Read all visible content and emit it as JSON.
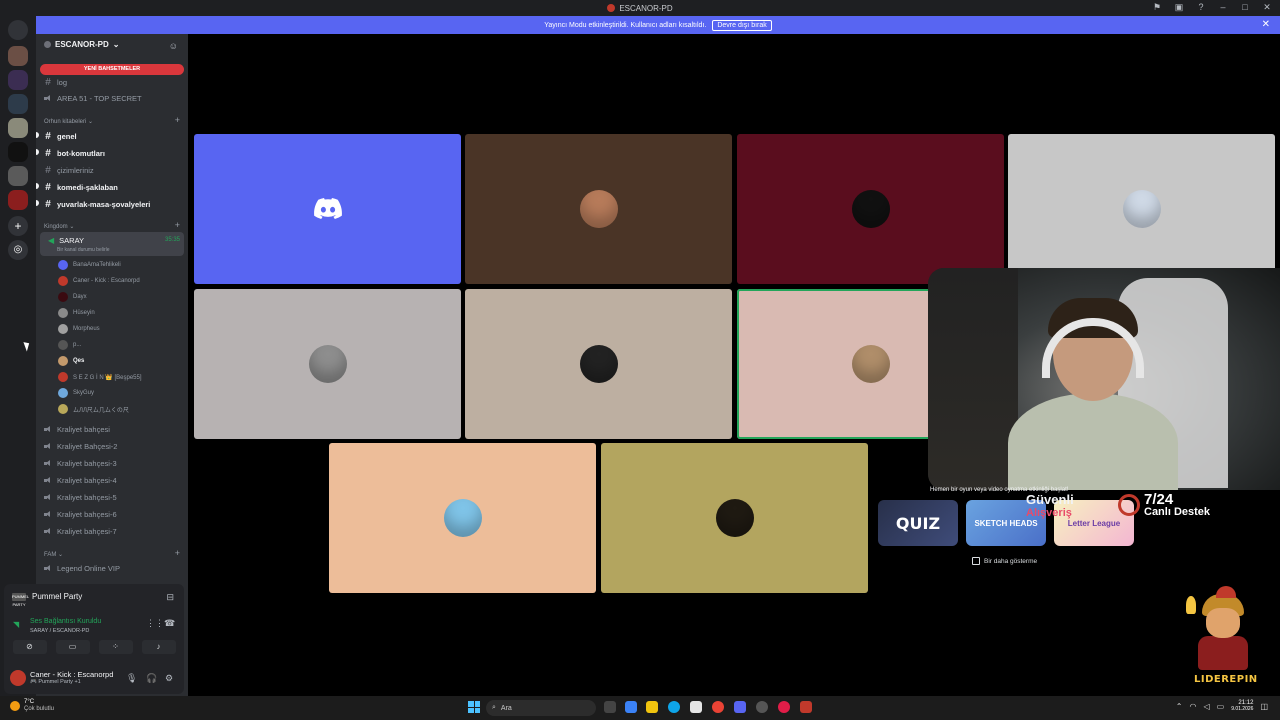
{
  "window": {
    "title": "ESCANOR-PD"
  },
  "banner": {
    "text": "Yayıncı Modu etkinleştirildi. Kullanıcı adları kısaltıldı.",
    "button": "Devre dışı bırak"
  },
  "server": {
    "name": "ESCANOR-PD"
  },
  "mentions_label": "YENİ BAHSETMELER",
  "channels_top": [
    {
      "name": "log",
      "type": "text"
    },
    {
      "name": "AREA 51 - TOP SECRET",
      "type": "voice"
    }
  ],
  "category_orhun": "Orhun kitabeleri",
  "channels_orhun": [
    {
      "name": "genel",
      "bold": true
    },
    {
      "name": "bot-komutları",
      "bold": true
    },
    {
      "name": "çizimleriniz",
      "bold": false
    },
    {
      "name": "komedi-şaklaban",
      "bold": true
    },
    {
      "name": "yuvarlak-masa-şovalyeleri",
      "bold": true
    }
  ],
  "category_kingdom": "Kingdom",
  "active_voice": {
    "name": "SARAY",
    "status_placeholder": "Bir kanal durumu belirle",
    "elapsed": "35:35"
  },
  "voice_members": [
    {
      "name": "BanaAmaTehlikeli",
      "color": "#5865f2",
      "bold": false
    },
    {
      "name": "Caner - Kick : Escanorpd",
      "color": "#c0392b",
      "bold": false
    },
    {
      "name": "Dayx",
      "color": "#3a0a10",
      "bold": false
    },
    {
      "name": "Hüseyin",
      "color": "#8a8a8a",
      "bold": false
    },
    {
      "name": "Morpheus",
      "color": "#a0a0a0",
      "bold": false
    },
    {
      "name": "p...",
      "color": "#555555",
      "bold": false
    },
    {
      "name": "Qes",
      "color": "#c49a6c",
      "bold": true
    },
    {
      "name": "S E Z G İ N 👑 [Beşpe55]",
      "color": "#c0392b",
      "bold": false
    },
    {
      "name": "SkyGuy",
      "color": "#6fa8dc",
      "bold": false
    },
    {
      "name": "ムЛЛ尺ム几ムくの尺",
      "color": "#b9a85a",
      "bold": false
    }
  ],
  "channels_kingdom": [
    "Kraliyet bahçesi",
    "Kraliyet Bahçesi-2",
    "Kraliyet bahçesi-3",
    "Kraliyet bahçesi-4",
    "Kraliyet bahçesi-5",
    "Kraliyet bahçesi-6",
    "Kraliyet bahçesi-7"
  ],
  "category_fam": "FAM",
  "channels_fam": [
    "Legend Online VIP"
  ],
  "panel": {
    "activity_name": "Pummel Party",
    "activity_logo": "PUMMEL PARTY",
    "voice_connected": "Ses Bağlantısı Kuruldu",
    "voice_location": "SARAY / ESCANOR-PD",
    "user_name": "Caner - Kick : Escanorpd",
    "user_status": "🎮 Pummel Party +1"
  },
  "tiles": [
    {
      "name": "tile-discord-default",
      "bg": "#5865f2",
      "avatar": "#5865f2",
      "speaking": false
    },
    {
      "name": "tile-user-2",
      "bg": "#4a3426",
      "avatar": "#b77b5a",
      "speaking": false
    },
    {
      "name": "tile-user-3",
      "bg": "#5a0d1e",
      "avatar": "#111111",
      "speaking": false
    },
    {
      "name": "tile-user-4",
      "bg": "#c7c7c7",
      "avatar": "#cfd9e6",
      "speaking": false
    },
    {
      "name": "tile-user-5",
      "bg": "#b7b2b2",
      "avatar": "#8e8e8e",
      "speaking": false
    },
    {
      "name": "tile-user-6",
      "bg": "#bdafa1",
      "avatar": "#222222",
      "speaking": false
    },
    {
      "name": "tile-user-7",
      "bg": "#d9bab2",
      "avatar": "#b08e6a",
      "speaking": true
    },
    {
      "name": "tile-user-8",
      "bg": "#edbd99",
      "avatar": "#7fc4e8",
      "speaking": false
    },
    {
      "name": "tile-user-9",
      "bg": "#b3a55f",
      "avatar": "#1f1a12",
      "speaking": false
    }
  ],
  "overlay": {
    "caption": "Hemen bir oyun veya video oynatma etkinliği başlat!",
    "ad1": "QUIZ",
    "ad2": "SKETCH HEADS",
    "ad3": "Letter League",
    "dont_show": "Bir daha gösterme",
    "brand_line1": "Güvenli",
    "brand_line2": "Alışveriş",
    "support_num": "7/24",
    "support_text": "Canlı Destek",
    "mascot_text": "LIDEREPIN"
  },
  "taskbar": {
    "temp": "7°C",
    "weather": "Çok bulutlu",
    "search": "Ara",
    "time": "21:12",
    "date": "9.01.2026"
  },
  "colors": {
    "accent": "#5865f2",
    "online": "#23a55a",
    "danger": "#da373c"
  }
}
